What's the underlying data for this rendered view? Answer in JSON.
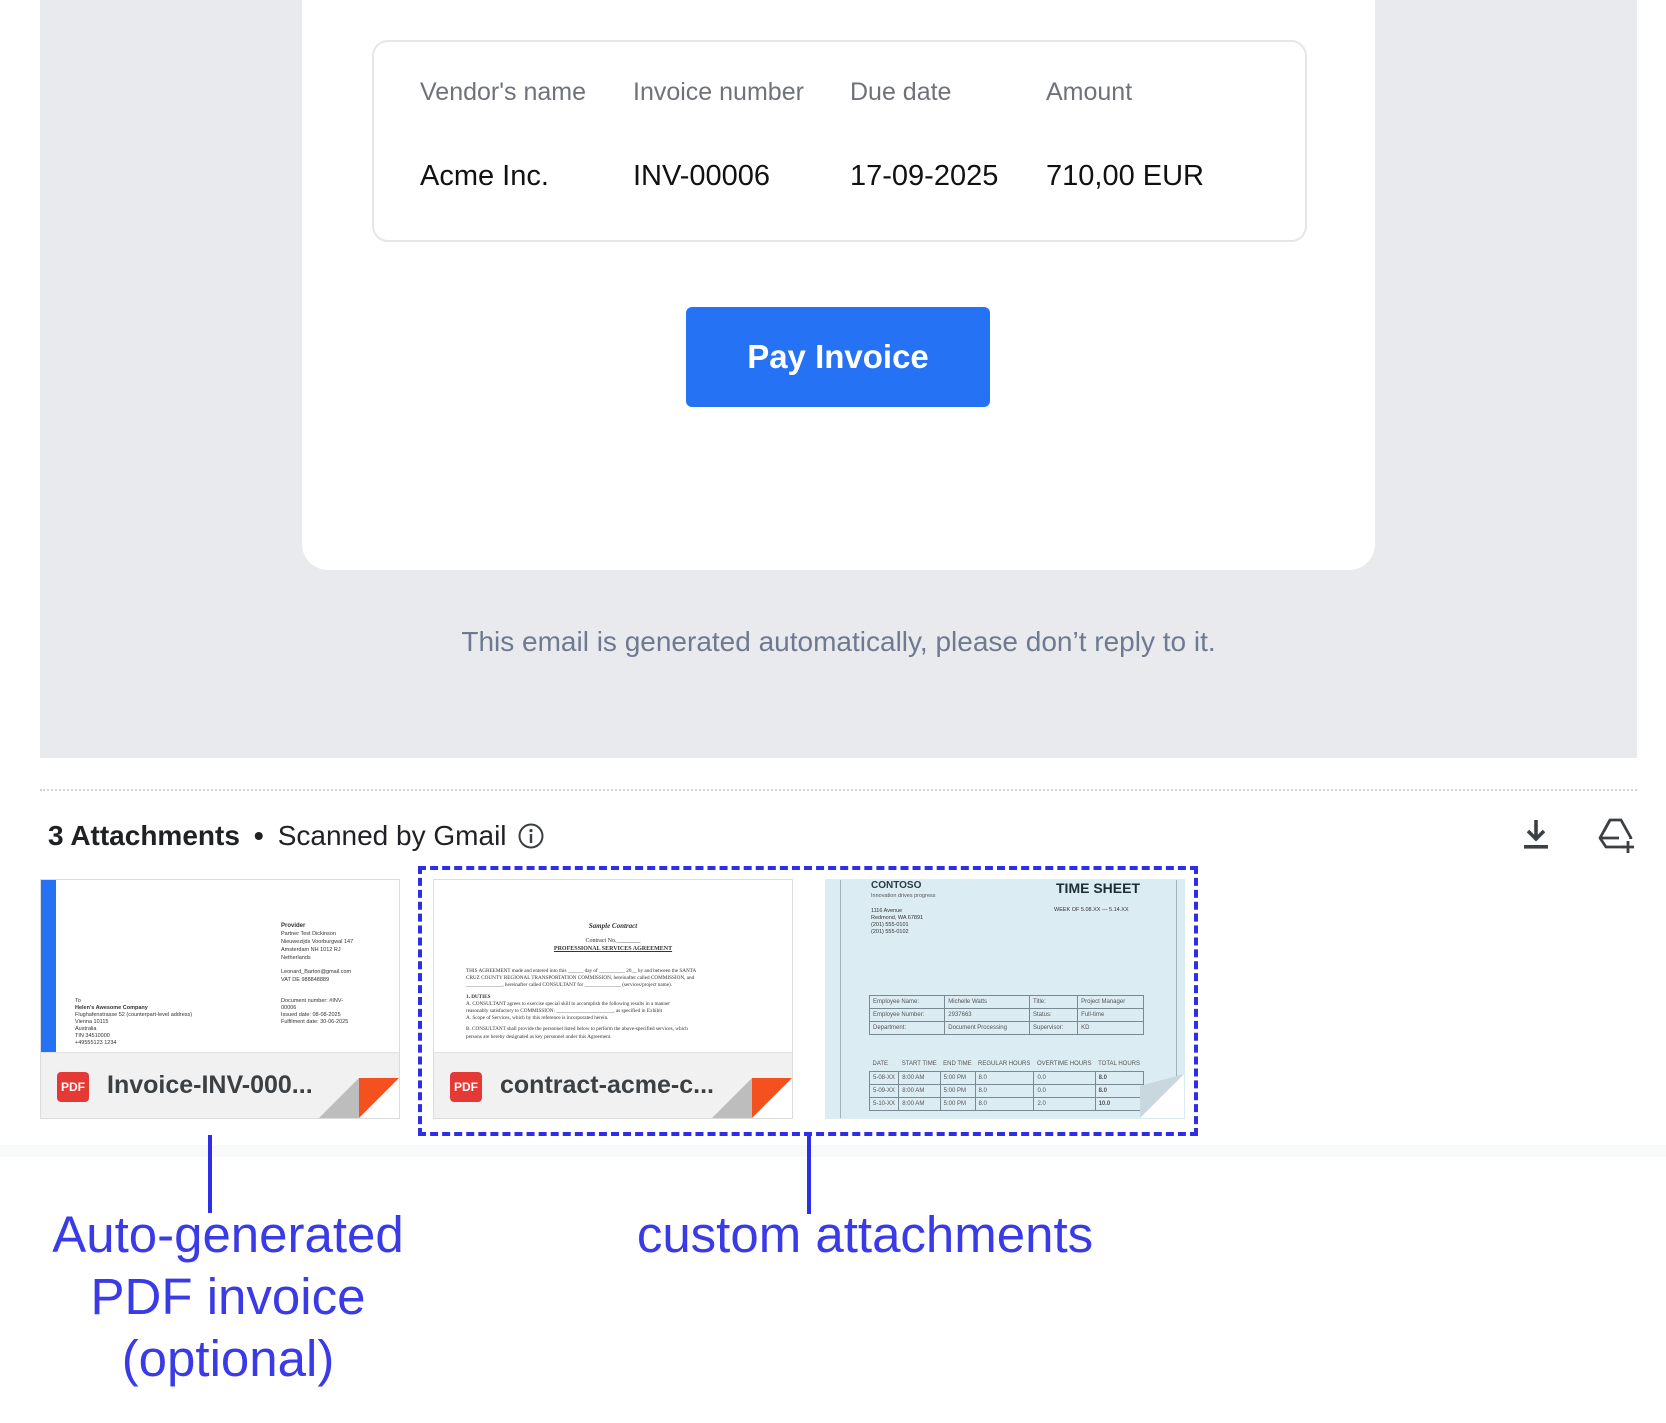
{
  "invoice": {
    "columns": [
      {
        "header": "Vendor's name",
        "value": "Acme Inc."
      },
      {
        "header": "Invoice number",
        "value": "INV-00006"
      },
      {
        "header": "Due date",
        "value": "17-09-2025"
      },
      {
        "header": "Amount",
        "value": "710,00 EUR"
      }
    ],
    "pay_button_label": "Pay Invoice",
    "footer_note": "This email is generated automatically, please don’t reply to it."
  },
  "attachments": {
    "count_label": "3 Attachments",
    "separator": "•",
    "scanned_label": "Scanned by Gmail",
    "actions": {
      "download_icon": "download-icon",
      "drive_icon": "add-to-drive-icon"
    },
    "items": [
      {
        "file_type": "PDF",
        "name": "Invoice-INV-000...",
        "preview": {
          "provider_title": "Provider",
          "provider_lines": [
            "Partner Test Dickinson",
            "Nieuwezijds Voorburgwal 147",
            "Amsterdam NH 1012 RJ",
            "Netherlands",
            "",
            "Leonard_Barton@gmail.com",
            "VAT DE 988848889"
          ],
          "to_label": "To",
          "to_company": "Helen's Awesome Company",
          "to_lines": [
            "Flughafenstrasse 52 (counterpart-level address)",
            "Vienna 10115",
            "Australia",
            "TIN 34510000",
            "+49555123 1234"
          ],
          "doc_lines": [
            "Document number: #INV-",
            "00006",
            "Issued date: 08-08-2025",
            "Fulfilment date: 30-06-2025"
          ]
        }
      },
      {
        "file_type": "PDF",
        "name": "contract-acme-c...",
        "preview": {
          "title": "Sample Contract",
          "contract_no": "Contract No.________",
          "agreement_title": "PROFESSIONAL SERVICES AGREEMENT",
          "lines": [
            "THIS AGREEMENT made and entered into this ______ day of __________ 20__ by and between the SANTA",
            "CRUZ COUNTY REGIONAL TRANSPORTATION COMMISSION, hereinafter called COMMISSION, and",
            "______________, hereinafter called CONSULTANT for ______________ (services/project name).",
            "",
            "1.   DUTIES",
            "   A.  CONSULTANT agrees to exercise special skill to accomplish the following results in a manner",
            "        reasonably satisfactory to COMMISSION: ______________________, as specified in Exhibit",
            "        A. Scope of Services, which by this reference is incorporated herein.",
            "",
            "   B.  CONSULTANT shall provide the personnel listed below to perform the above-specified services, which",
            "        persons are hereby designated as key personnel under this Agreement."
          ]
        }
      },
      {
        "file_type": "image",
        "name": "",
        "preview": {
          "company": "CONTOSO",
          "tagline": "Innovation drives progress",
          "address_lines": [
            "1116 Avenue",
            "Redmond, WA 67891",
            "(201) 555-0101",
            "(201) 555-0102"
          ],
          "title": "TIME SHEET",
          "week": "WEEK OF 5.08.XX — 5.14.XX",
          "employee_rows": [
            [
              "Employee Name:",
              "Michelle Watts",
              "Title:",
              "Project Manager"
            ],
            [
              "Employee Number:",
              "2937663",
              "Status:",
              "Full-time"
            ],
            [
              "Department:",
              "Document Processing",
              "Supervisor:",
              "KD"
            ]
          ],
          "hours_headers": [
            "DATE",
            "START TIME",
            "END TIME",
            "REGULAR HOURS",
            "OVERTIME HOURS",
            "TOTAL HOURS"
          ],
          "hours_rows": [
            [
              "5-08-XX",
              "8:00 AM",
              "5:00 PM",
              "8.0",
              "0.0",
              "8.0"
            ],
            [
              "5-09-XX",
              "8:00 AM",
              "5:00 PM",
              "8.0",
              "0.0",
              "8.0"
            ],
            [
              "5-10-XX",
              "8:00 AM",
              "5:00 PM",
              "8.0",
              "2.0",
              "10.0"
            ]
          ]
        }
      }
    ]
  },
  "annotations": {
    "left_lines": [
      "Auto-generated",
      "PDF invoice",
      "(optional)"
    ],
    "right": "custom attachments"
  },
  "colors": {
    "accent": "#2572f4",
    "annotation": "#2e2ee8",
    "pdf_badge": "#e53935"
  }
}
